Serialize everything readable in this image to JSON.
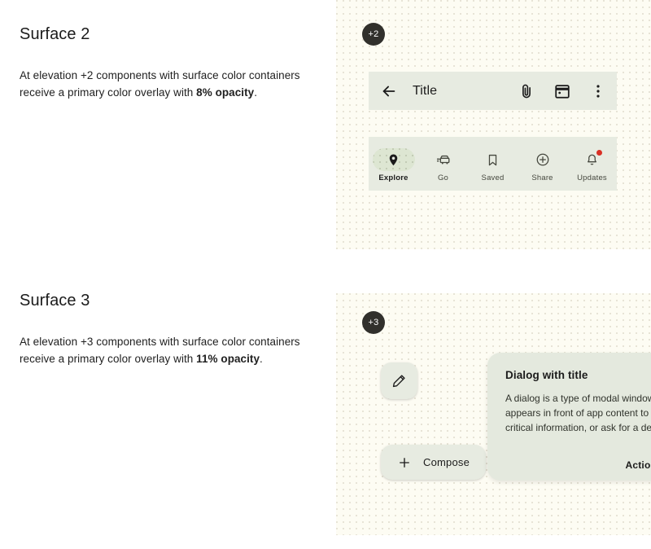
{
  "sections": [
    {
      "id": "surface-2",
      "title": "Surface 2",
      "body_prefix": "At elevation +2 components with surface color containers receive a primary color overlay with ",
      "body_strong": "8% opacity",
      "body_suffix": ".",
      "badge": "+2"
    },
    {
      "id": "surface-3",
      "title": "Surface 3",
      "body_prefix": "At elevation +3 components with surface color containers receive a primary color overlay with ",
      "body_strong": "11% opacity",
      "body_suffix": ".",
      "badge": "+3"
    }
  ],
  "app_bar": {
    "back_icon": "arrow-back-icon",
    "title": "Title",
    "actions": [
      {
        "icon": "attach-file-icon",
        "name": "attach-file-button"
      },
      {
        "icon": "calendar-icon",
        "name": "calendar-button"
      },
      {
        "icon": "more-vert-icon",
        "name": "overflow-menu-button"
      }
    ]
  },
  "nav_bar": {
    "items": [
      {
        "label": "Explore",
        "icon": "place-pin-icon",
        "active": true,
        "badge": false
      },
      {
        "label": "Go",
        "icon": "directions-car-icon",
        "active": false,
        "badge": false
      },
      {
        "label": "Saved",
        "icon": "bookmark-icon",
        "active": false,
        "badge": false
      },
      {
        "label": "Share",
        "icon": "add-circle-icon",
        "active": false,
        "badge": false
      },
      {
        "label": "Updates",
        "icon": "notifications-icon",
        "active": false,
        "badge": true
      }
    ]
  },
  "fab": {
    "icon": "edit-pencil-icon"
  },
  "fab_extended": {
    "icon": "plus-icon",
    "label": "Compose"
  },
  "dialog": {
    "title": "Dialog with title",
    "body": "A dialog is a type of modal window that appears in front of app content to provide critical information, or ask for a decision.",
    "action_label": "Action"
  },
  "colors": {
    "panel_background": "#FDFCF3",
    "surface_container": "#E7EBE1",
    "dialog_surface": "#E4E9DE",
    "active_indicator": "#DDE6D2",
    "badge_dark": "#31302C",
    "notification_red": "#D93025",
    "text_primary": "#1B1B1B"
  }
}
